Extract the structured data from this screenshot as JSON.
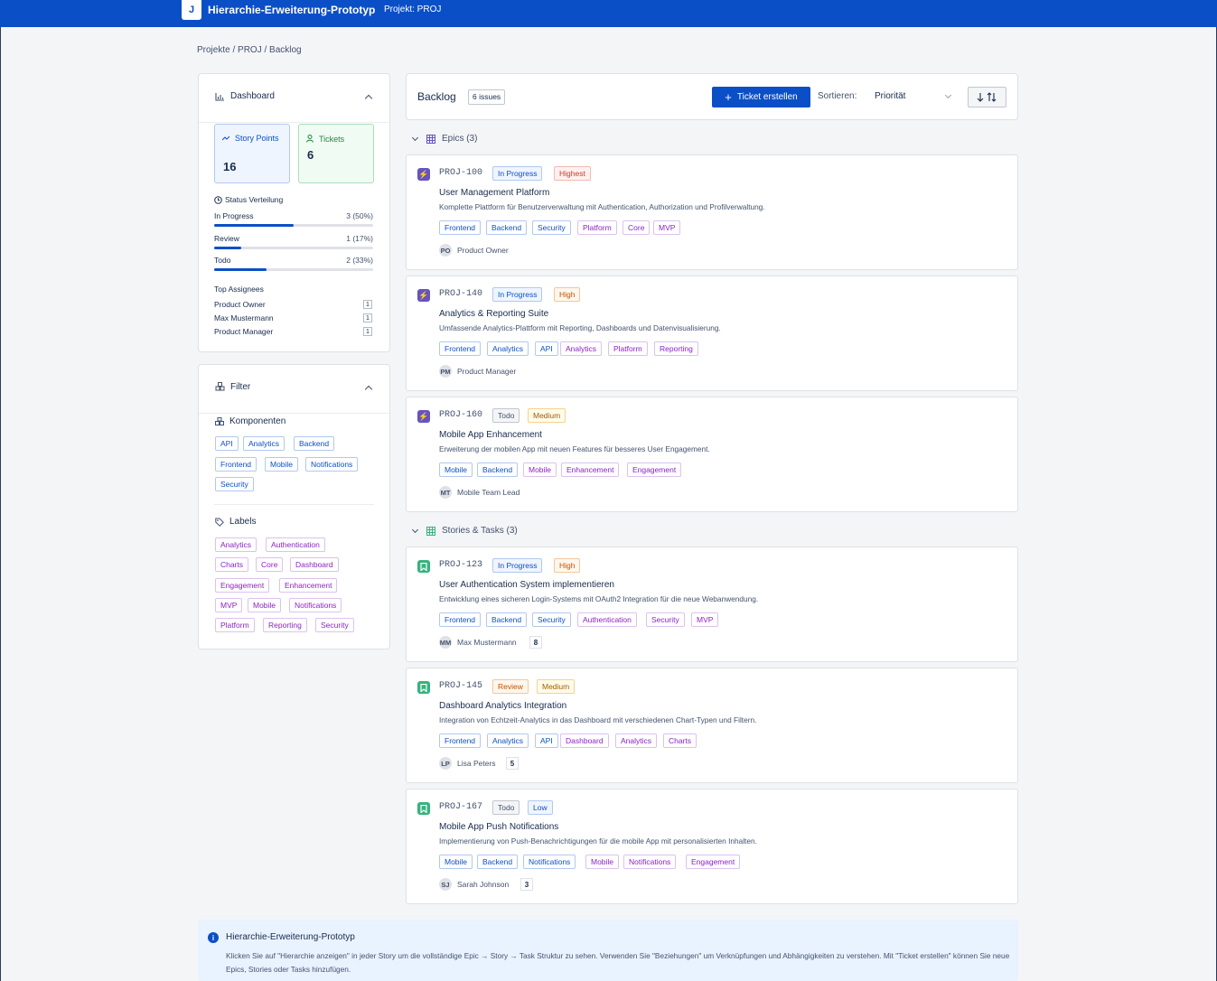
{
  "header": {
    "logo": "J",
    "title": "Hierarchie-Erweiterung-Prototyp",
    "project": "Projekt: PROJ"
  },
  "breadcrumb": "Projekte / PROJ / Backlog",
  "dashboard": {
    "title": "Dashboard",
    "story_points": {
      "label": "Story Points",
      "value": "16"
    },
    "tickets": {
      "label": "Tickets",
      "value": "6"
    },
    "status_title": "Status Verteilung",
    "status": [
      {
        "label": "In Progress",
        "count": "3 (50%)",
        "fraction": 0.5
      },
      {
        "label": "Review",
        "count": "1 (17%)",
        "fraction": 0.17
      },
      {
        "label": "Todo",
        "count": "2 (33%)",
        "fraction": 0.33
      }
    ],
    "assignees_title": "Top Assignees",
    "assignees": [
      {
        "name": "Product Owner",
        "count": "1"
      },
      {
        "name": "Max Mustermann",
        "count": "1"
      },
      {
        "name": "Product Manager",
        "count": "1"
      }
    ]
  },
  "filter": {
    "title": "Filter",
    "components_title": "Komponenten",
    "components": [
      "API",
      "Analytics",
      "Backend",
      "Frontend",
      "Mobile",
      "Notifications",
      "Security"
    ],
    "labels_title": "Labels",
    "labels": [
      "Analytics",
      "Authentication",
      "Charts",
      "Core",
      "Dashboard",
      "Engagement",
      "Enhancement",
      "MVP",
      "Mobile",
      "Notifications",
      "Platform",
      "Reporting",
      "Security"
    ]
  },
  "backlog": {
    "title": "Backlog",
    "count": "6 issues",
    "create_button": "Ticket erstellen",
    "sort_label": "Sortieren:",
    "sort_value": "Priorität",
    "epics_header": "Epics (3)",
    "stories_header": "Stories & Tasks (3)"
  },
  "cards": [
    {
      "key": "PROJ-100",
      "status": "In Progress",
      "priority": "Highest",
      "title": "User Management Platform",
      "desc": "Komplette Plattform für Benutzerverwaltung mit Authentication, Authorization und Profilverwaltung.",
      "components": [
        "Frontend",
        "Backend",
        "Security"
      ],
      "labels": [
        "Platform",
        "Core",
        "MVP"
      ],
      "initials": "PO",
      "assignee": "Product Owner",
      "points": ""
    },
    {
      "key": "PROJ-140",
      "status": "In Progress",
      "priority": "High",
      "title": "Analytics & Reporting Suite",
      "desc": "Umfassende Analytics-Plattform mit Reporting, Dashboards und Datenvisualisierung.",
      "components": [
        "Frontend",
        "Analytics",
        "API"
      ],
      "labels": [
        "Analytics",
        "Platform",
        "Reporting"
      ],
      "initials": "PM",
      "assignee": "Product Manager",
      "points": ""
    },
    {
      "key": "PROJ-160",
      "status": "Todo",
      "priority": "Medium",
      "title": "Mobile App Enhancement",
      "desc": "Erweiterung der mobilen App mit neuen Features für besseres User Engagement.",
      "components": [
        "Mobile",
        "Backend"
      ],
      "labels": [
        "Mobile",
        "Enhancement",
        "Engagement"
      ],
      "initials": "MT",
      "assignee": "Mobile Team Lead",
      "points": ""
    },
    {
      "key": "PROJ-123",
      "status": "In Progress",
      "priority": "High",
      "title": "User Authentication System implementieren",
      "desc": "Entwicklung eines sicheren Login-Systems mit OAuth2 Integration für die neue Webanwendung.",
      "components": [
        "Frontend",
        "Backend",
        "Security"
      ],
      "labels": [
        "Authentication",
        "Security",
        "MVP"
      ],
      "initials": "MM",
      "assignee": "Max Mustermann",
      "points": "8"
    },
    {
      "key": "PROJ-145",
      "status": "Review",
      "priority": "Medium",
      "title": "Dashboard Analytics Integration",
      "desc": "Integration von Echtzeit-Analytics in das Dashboard mit verschiedenen Chart-Typen und Filtern.",
      "components": [
        "Frontend",
        "Analytics",
        "API"
      ],
      "labels": [
        "Dashboard",
        "Analytics",
        "Charts"
      ],
      "initials": "LP",
      "assignee": "Lisa Peters",
      "points": "5"
    },
    {
      "key": "PROJ-167",
      "status": "Todo",
      "priority": "Low",
      "title": "Mobile App Push Notifications",
      "desc": "Implementierung von Push-Benachrichtigungen für die mobile App mit personalisierten Inhalten.",
      "components": [
        "Mobile",
        "Backend",
        "Notifications"
      ],
      "labels": [
        "Mobile",
        "Notifications",
        "Engagement"
      ],
      "initials": "SJ",
      "assignee": "Sarah Johnson",
      "points": "3"
    }
  ],
  "info": {
    "title": "Hierarchie-Erweiterung-Prototyp",
    "text": "Klicken Sie auf \"Hierarchie anzeigen\" in jeder Story um die vollständige Epic → Story → Task Struktur zu sehen. Verwenden Sie \"Beziehungen\" um Verknüpfungen und Abhängigkeiten zu verstehen. Mit \"Ticket erstellen\" können Sie neue Epics, Stories oder Tasks hinzufügen."
  }
}
